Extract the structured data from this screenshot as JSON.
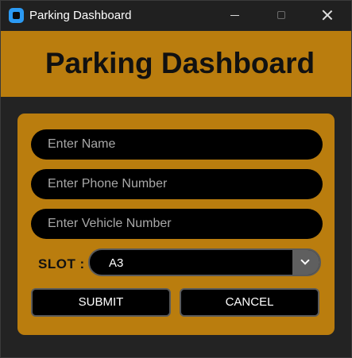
{
  "window": {
    "title": "Parking Dashboard",
    "icons": {
      "app": "app-icon",
      "minimize": "minimize-icon",
      "maximize": "maximize-icon",
      "close": "close-icon"
    }
  },
  "header": {
    "title": "Parking Dashboard"
  },
  "form": {
    "name_placeholder": "Enter Name",
    "phone_placeholder": "Enter Phone Number",
    "vehicle_placeholder": "Enter Vehicle Number",
    "slot_label": "SLOT :",
    "slot_value": "A3",
    "submit_label": "SUBMIT",
    "cancel_label": "CANCEL"
  },
  "colors": {
    "accent": "#ba7d0e",
    "background": "#232323",
    "field_background": "#000000",
    "placeholder_text": "#a8a8a8"
  }
}
